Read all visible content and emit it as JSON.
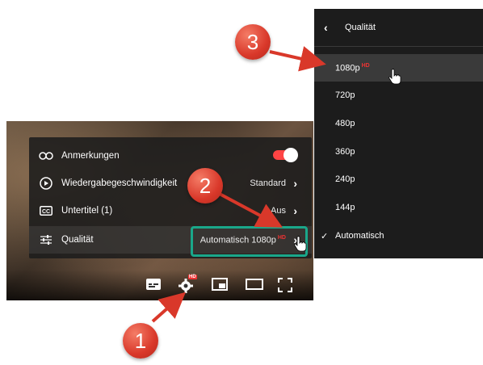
{
  "settings_menu": {
    "rows": [
      {
        "label": "Anmerkungen",
        "value": "",
        "icon": "annotations-icon"
      },
      {
        "label": "Wiedergabegeschwindigkeit",
        "value": "Standard",
        "icon": "speed-icon"
      },
      {
        "label": "Untertitel (1)",
        "value": "Aus",
        "icon": "cc-icon"
      },
      {
        "label": "Qualität",
        "value": "Automatisch 1080p",
        "hd": "HD",
        "icon": "sliders-icon"
      }
    ],
    "annotations_toggle": "on"
  },
  "controlbar": {
    "icons": [
      "subtitles-icon",
      "settings-gear-icon",
      "miniplayer-icon",
      "theater-mode-icon",
      "fullscreen-icon"
    ],
    "gear_badge": "HD"
  },
  "quality_menu": {
    "title": "Qualität",
    "items": [
      {
        "label": "1080p",
        "hd": "HD"
      },
      {
        "label": "720p"
      },
      {
        "label": "480p"
      },
      {
        "label": "360p"
      },
      {
        "label": "240p"
      },
      {
        "label": "144p"
      },
      {
        "label": "Automatisch",
        "checked": true
      }
    ]
  },
  "callouts": {
    "one": "1",
    "two": "2",
    "three": "3"
  },
  "colors": {
    "accent_red": "#e33",
    "highlight": "#1aa78a",
    "badge": "#d9382a",
    "menu_bg": "#1c1c1c"
  }
}
